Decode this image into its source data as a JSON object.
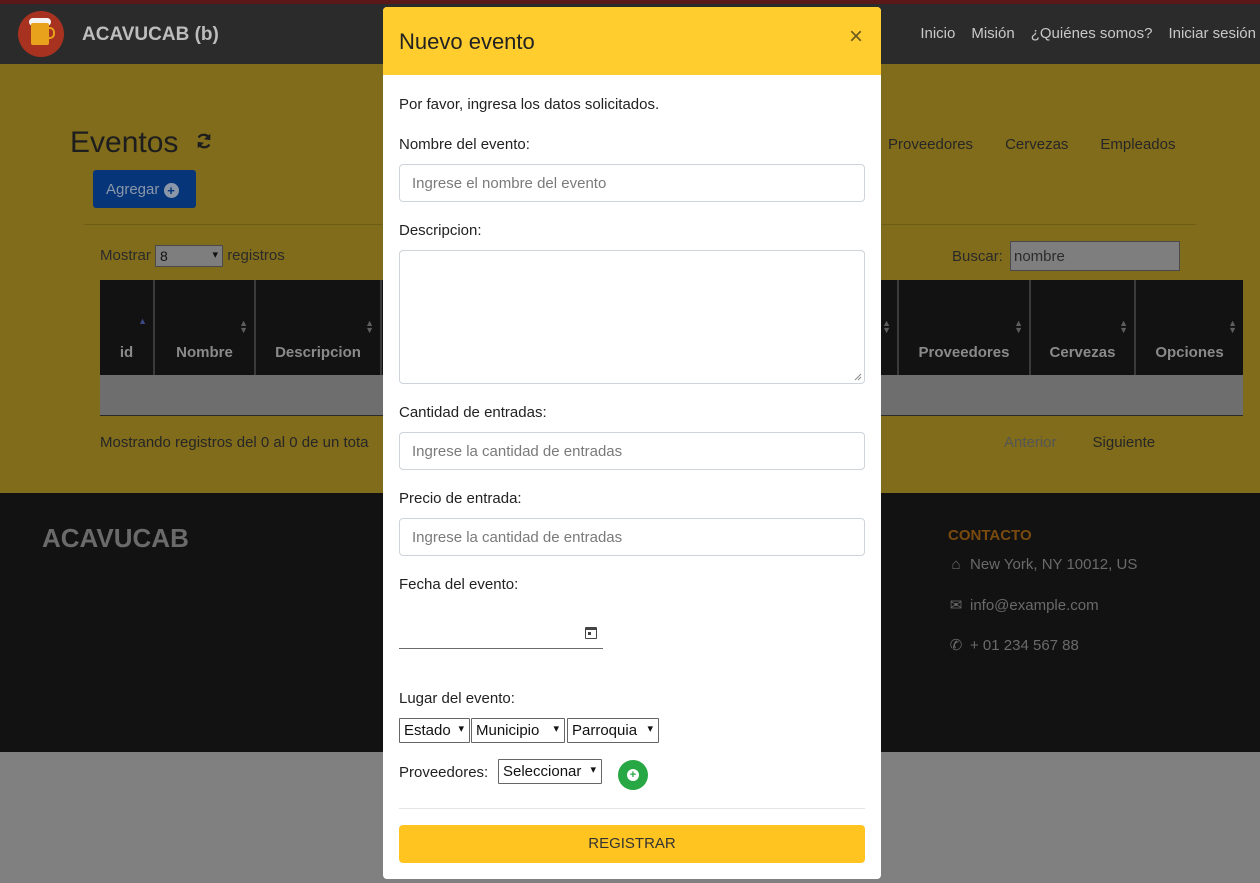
{
  "app": {
    "brand": "ACAVUCAB (b)",
    "nav": [
      "Inicio",
      "Misión",
      "¿Quiénes somos?",
      "Iniciar sesión"
    ]
  },
  "page": {
    "title": "Eventos",
    "add_label": "Agregar",
    "subnav": [
      "Proveedores",
      "Cervezas",
      "Empleados"
    ],
    "show_prefix": "Mostrar",
    "show_value": "8",
    "show_suffix": "registros",
    "search_label": "Buscar:",
    "search_value": "nombre",
    "columns": [
      "id",
      "Nombre",
      "Descripcion",
      "Proveedores",
      "Cervezas",
      "Opciones"
    ],
    "footnote": "Mostrando registros del 0 al 0 de un tota",
    "prev_label": "Anterior",
    "next_label": "Siguiente"
  },
  "footer": {
    "brand": "ACAVUCAB",
    "contact_title": "CONTACTO",
    "address": "New York, NY 10012, US",
    "email": "info@example.com",
    "phone": "+ 01 234 567 88"
  },
  "modal": {
    "title": "Nuevo evento",
    "close": "×",
    "intro": "Por favor, ingresa los datos solicitados.",
    "name_label": "Nombre del evento:",
    "name_placeholder": "Ingrese el nombre del evento",
    "desc_label": "Descripcion:",
    "tickets_label": "Cantidad de entradas:",
    "tickets_placeholder": "Ingrese la cantidad de entradas",
    "price_label": "Precio de entrada:",
    "price_placeholder": "Ingrese la cantidad de entradas",
    "date_label": "Fecha del evento:",
    "place_label": "Lugar del evento:",
    "estado": "Estado",
    "municipio": "Municipio",
    "parroquia": "Parroquia",
    "providers_label": "Proveedores:",
    "providers_select": "Seleccionar",
    "register_label": "REGISTRAR"
  },
  "colors": {
    "modal_header": "#ffcd2e",
    "register_button": "#ffc41f",
    "add_provider": "#28a745",
    "overlay": "#808080"
  }
}
